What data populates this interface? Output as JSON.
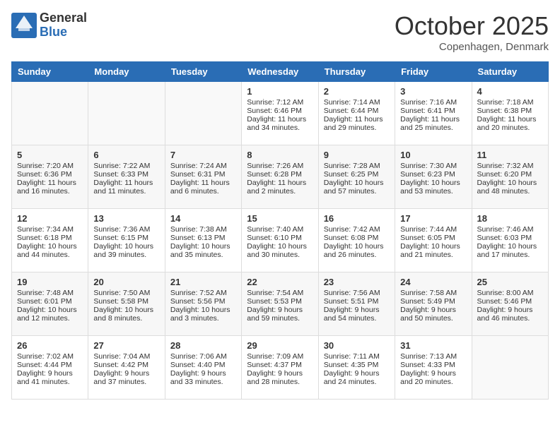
{
  "header": {
    "logo_general": "General",
    "logo_blue": "Blue",
    "month": "October 2025",
    "location": "Copenhagen, Denmark"
  },
  "days": [
    "Sunday",
    "Monday",
    "Tuesday",
    "Wednesday",
    "Thursday",
    "Friday",
    "Saturday"
  ],
  "weeks": [
    [
      {
        "day": "",
        "lines": []
      },
      {
        "day": "",
        "lines": []
      },
      {
        "day": "",
        "lines": []
      },
      {
        "day": "1",
        "lines": [
          "Sunrise: 7:12 AM",
          "Sunset: 6:46 PM",
          "Daylight: 11 hours",
          "and 34 minutes."
        ]
      },
      {
        "day": "2",
        "lines": [
          "Sunrise: 7:14 AM",
          "Sunset: 6:44 PM",
          "Daylight: 11 hours",
          "and 29 minutes."
        ]
      },
      {
        "day": "3",
        "lines": [
          "Sunrise: 7:16 AM",
          "Sunset: 6:41 PM",
          "Daylight: 11 hours",
          "and 25 minutes."
        ]
      },
      {
        "day": "4",
        "lines": [
          "Sunrise: 7:18 AM",
          "Sunset: 6:38 PM",
          "Daylight: 11 hours",
          "and 20 minutes."
        ]
      }
    ],
    [
      {
        "day": "5",
        "lines": [
          "Sunrise: 7:20 AM",
          "Sunset: 6:36 PM",
          "Daylight: 11 hours",
          "and 16 minutes."
        ]
      },
      {
        "day": "6",
        "lines": [
          "Sunrise: 7:22 AM",
          "Sunset: 6:33 PM",
          "Daylight: 11 hours",
          "and 11 minutes."
        ]
      },
      {
        "day": "7",
        "lines": [
          "Sunrise: 7:24 AM",
          "Sunset: 6:31 PM",
          "Daylight: 11 hours",
          "and 6 minutes."
        ]
      },
      {
        "day": "8",
        "lines": [
          "Sunrise: 7:26 AM",
          "Sunset: 6:28 PM",
          "Daylight: 11 hours",
          "and 2 minutes."
        ]
      },
      {
        "day": "9",
        "lines": [
          "Sunrise: 7:28 AM",
          "Sunset: 6:25 PM",
          "Daylight: 10 hours",
          "and 57 minutes."
        ]
      },
      {
        "day": "10",
        "lines": [
          "Sunrise: 7:30 AM",
          "Sunset: 6:23 PM",
          "Daylight: 10 hours",
          "and 53 minutes."
        ]
      },
      {
        "day": "11",
        "lines": [
          "Sunrise: 7:32 AM",
          "Sunset: 6:20 PM",
          "Daylight: 10 hours",
          "and 48 minutes."
        ]
      }
    ],
    [
      {
        "day": "12",
        "lines": [
          "Sunrise: 7:34 AM",
          "Sunset: 6:18 PM",
          "Daylight: 10 hours",
          "and 44 minutes."
        ]
      },
      {
        "day": "13",
        "lines": [
          "Sunrise: 7:36 AM",
          "Sunset: 6:15 PM",
          "Daylight: 10 hours",
          "and 39 minutes."
        ]
      },
      {
        "day": "14",
        "lines": [
          "Sunrise: 7:38 AM",
          "Sunset: 6:13 PM",
          "Daylight: 10 hours",
          "and 35 minutes."
        ]
      },
      {
        "day": "15",
        "lines": [
          "Sunrise: 7:40 AM",
          "Sunset: 6:10 PM",
          "Daylight: 10 hours",
          "and 30 minutes."
        ]
      },
      {
        "day": "16",
        "lines": [
          "Sunrise: 7:42 AM",
          "Sunset: 6:08 PM",
          "Daylight: 10 hours",
          "and 26 minutes."
        ]
      },
      {
        "day": "17",
        "lines": [
          "Sunrise: 7:44 AM",
          "Sunset: 6:05 PM",
          "Daylight: 10 hours",
          "and 21 minutes."
        ]
      },
      {
        "day": "18",
        "lines": [
          "Sunrise: 7:46 AM",
          "Sunset: 6:03 PM",
          "Daylight: 10 hours",
          "and 17 minutes."
        ]
      }
    ],
    [
      {
        "day": "19",
        "lines": [
          "Sunrise: 7:48 AM",
          "Sunset: 6:01 PM",
          "Daylight: 10 hours",
          "and 12 minutes."
        ]
      },
      {
        "day": "20",
        "lines": [
          "Sunrise: 7:50 AM",
          "Sunset: 5:58 PM",
          "Daylight: 10 hours",
          "and 8 minutes."
        ]
      },
      {
        "day": "21",
        "lines": [
          "Sunrise: 7:52 AM",
          "Sunset: 5:56 PM",
          "Daylight: 10 hours",
          "and 3 minutes."
        ]
      },
      {
        "day": "22",
        "lines": [
          "Sunrise: 7:54 AM",
          "Sunset: 5:53 PM",
          "Daylight: 9 hours",
          "and 59 minutes."
        ]
      },
      {
        "day": "23",
        "lines": [
          "Sunrise: 7:56 AM",
          "Sunset: 5:51 PM",
          "Daylight: 9 hours",
          "and 54 minutes."
        ]
      },
      {
        "day": "24",
        "lines": [
          "Sunrise: 7:58 AM",
          "Sunset: 5:49 PM",
          "Daylight: 9 hours",
          "and 50 minutes."
        ]
      },
      {
        "day": "25",
        "lines": [
          "Sunrise: 8:00 AM",
          "Sunset: 5:46 PM",
          "Daylight: 9 hours",
          "and 46 minutes."
        ]
      }
    ],
    [
      {
        "day": "26",
        "lines": [
          "Sunrise: 7:02 AM",
          "Sunset: 4:44 PM",
          "Daylight: 9 hours",
          "and 41 minutes."
        ]
      },
      {
        "day": "27",
        "lines": [
          "Sunrise: 7:04 AM",
          "Sunset: 4:42 PM",
          "Daylight: 9 hours",
          "and 37 minutes."
        ]
      },
      {
        "day": "28",
        "lines": [
          "Sunrise: 7:06 AM",
          "Sunset: 4:40 PM",
          "Daylight: 9 hours",
          "and 33 minutes."
        ]
      },
      {
        "day": "29",
        "lines": [
          "Sunrise: 7:09 AM",
          "Sunset: 4:37 PM",
          "Daylight: 9 hours",
          "and 28 minutes."
        ]
      },
      {
        "day": "30",
        "lines": [
          "Sunrise: 7:11 AM",
          "Sunset: 4:35 PM",
          "Daylight: 9 hours",
          "and 24 minutes."
        ]
      },
      {
        "day": "31",
        "lines": [
          "Sunrise: 7:13 AM",
          "Sunset: 4:33 PM",
          "Daylight: 9 hours",
          "and 20 minutes."
        ]
      },
      {
        "day": "",
        "lines": []
      }
    ]
  ]
}
